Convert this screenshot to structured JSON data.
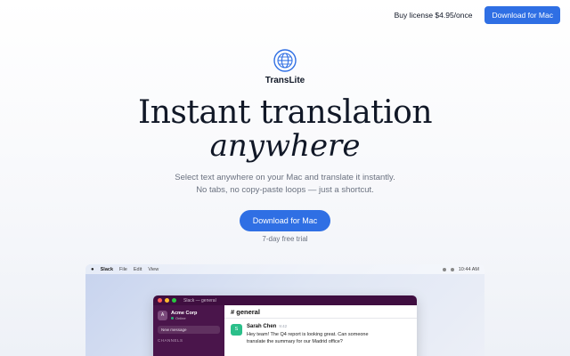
{
  "nav": {
    "buy_label": "Buy license $4.95/once",
    "download_label": "Download for Mac"
  },
  "brand": {
    "name": "TransLite",
    "icon": "globe-icon",
    "accent": "#2f6fe4"
  },
  "hero": {
    "line1": "Instant translation",
    "line2": "anywhere",
    "sub1": "Select text anywhere on your Mac and translate it instantly.",
    "sub2": "No tabs, no copy-paste loops — just a shortcut.",
    "cta": "Download for Mac",
    "trial": "7-day free trial"
  },
  "mock": {
    "menubar": {
      "app": "Slack",
      "menus": [
        "File",
        "Edit",
        "View"
      ],
      "time": "10:44 AM"
    },
    "window_title": "Slack — general",
    "workspace": {
      "initial": "A",
      "name": "Acme Corp",
      "status": "Online"
    },
    "new_message": "New message",
    "channels_label": "CHANNELS",
    "channel": "# general",
    "message": {
      "initial": "S",
      "author": "Sarah Chen",
      "time": "9:42",
      "text1": "Hey team! The Q4 report is looking great. Can someone",
      "text2": "translate the summary for our Madrid office?"
    }
  }
}
